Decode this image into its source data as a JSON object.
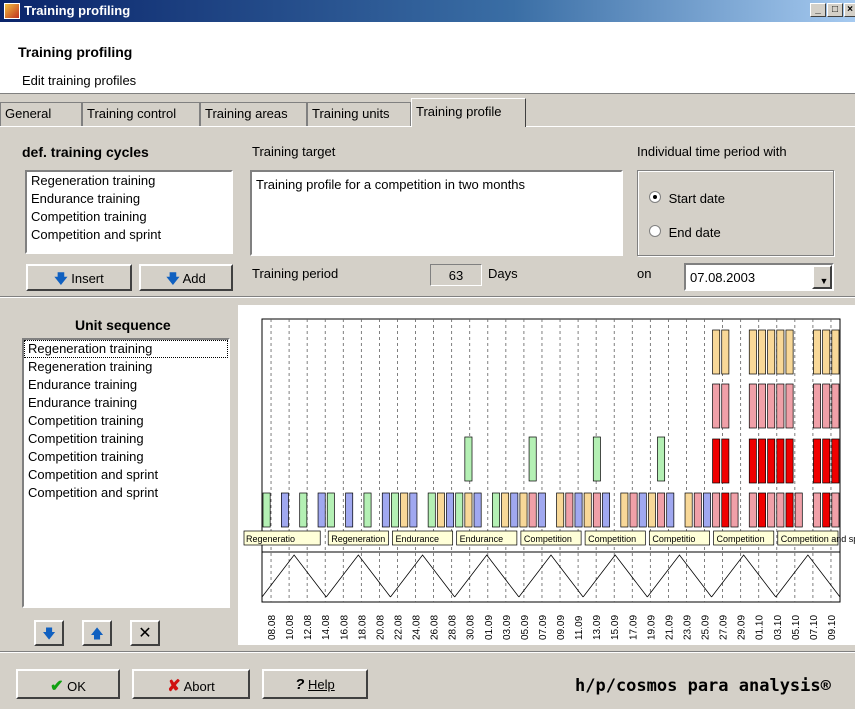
{
  "window": {
    "title": "Training profiling",
    "minimize": "_",
    "maximize": "□",
    "close": "×"
  },
  "header": {
    "title": "Training profiling",
    "subtitle": "Edit training profiles"
  },
  "tabs": [
    {
      "label": "General"
    },
    {
      "label": "Training control"
    },
    {
      "label": "Training areas"
    },
    {
      "label": "Training units"
    },
    {
      "label": "Training profile"
    }
  ],
  "cycles": {
    "heading": "def. training cycles",
    "items": [
      "Regeneration training",
      "Endurance training",
      "Competition training",
      "Competition and sprint"
    ],
    "insert_label": "Insert",
    "add_label": "Add"
  },
  "target": {
    "label": "Training target",
    "text": "Training profile for a competition in two months",
    "period_label": "Training period",
    "period_value": "63",
    "period_unit": "Days"
  },
  "time_period": {
    "label": "Individual time period with",
    "start_label": "Start date",
    "end_label": "End date",
    "selected": "start",
    "on_label": "on",
    "date": "07.08.2003"
  },
  "unit_sequence": {
    "heading": "Unit sequence",
    "items": [
      "Regeneration training",
      "Regeneration training",
      "Endurance training",
      "Endurance training",
      "Competition training",
      "Competition training",
      "Competition training",
      "Competition and sprint",
      "Competition and sprint"
    ]
  },
  "chart_data": {
    "type": "bar",
    "dates": [
      "08.08",
      "10.08",
      "12.08",
      "14.08",
      "16.08",
      "18.08",
      "20.08",
      "22.08",
      "24.08",
      "26.08",
      "28.08",
      "30.08",
      "01.09",
      "03.09",
      "05.09",
      "07.09",
      "09.09",
      "11.09",
      "13.09",
      "15.09",
      "17.09",
      "19.09",
      "21.09",
      "23.09",
      "25.09",
      "27.09",
      "29.09",
      "01.10",
      "03.10",
      "05.10",
      "07.10",
      "09.10"
    ],
    "segments": [
      "Regeneratio",
      "Regeneration",
      "Endurance",
      "Endurance",
      "Competition",
      "Competition",
      "Competitio",
      "Competition",
      "Competition and sprint"
    ],
    "colors": {
      "green": "#b4f0b4",
      "blue": "#a0a8f0",
      "yellow": "#f8d898",
      "pink": "#f0a0a8",
      "red": "#f00000"
    }
  },
  "footer": {
    "ok_label": "OK",
    "abort_label": "Abort",
    "help_label": "Help",
    "brand": "h/p/cosmos para analysis®"
  }
}
